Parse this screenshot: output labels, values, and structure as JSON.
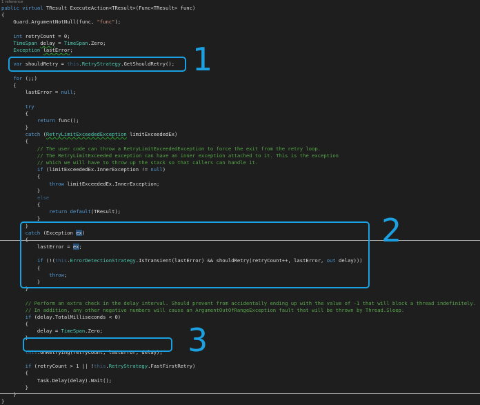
{
  "editor": {
    "reference_lens": "1 reference",
    "lines": [
      [
        {
          "t": "public ",
          "c": "kw"
        },
        {
          "t": "virtual ",
          "c": "kw"
        },
        {
          "t": "TResult ExecuteAction<TResult>(Func<TResult> func)",
          "c": "id"
        }
      ],
      [
        {
          "t": "{",
          "c": "id"
        }
      ],
      [
        {
          "t": "    Guard.ArgumentNotNull(func, ",
          "c": "id"
        },
        {
          "t": "\"func\"",
          "c": "st"
        },
        {
          "t": ");",
          "c": "id"
        }
      ],
      [],
      [
        {
          "t": "    ",
          "c": "id"
        },
        {
          "t": "int",
          "c": "kw"
        },
        {
          "t": " retryCount = 0;",
          "c": "id"
        }
      ],
      [
        {
          "t": "    ",
          "c": "id"
        },
        {
          "t": "TimeSpan",
          "c": "ty"
        },
        {
          "t": " ",
          "c": "id"
        },
        {
          "t": "delay",
          "c": "id sq"
        },
        {
          "t": " = ",
          "c": "id"
        },
        {
          "t": "TimeSpan",
          "c": "ty"
        },
        {
          "t": ".Zero;",
          "c": "id"
        }
      ],
      [
        {
          "t": "    Exception ",
          "c": "ty"
        },
        {
          "t": "lastError",
          "c": "id sq"
        },
        {
          "t": ";",
          "c": "id"
        }
      ],
      [],
      [
        {
          "t": "    ",
          "c": "id"
        },
        {
          "t": "var",
          "c": "kw"
        },
        {
          "t": " shouldRetry = ",
          "c": "id"
        },
        {
          "t": "this",
          "c": "this"
        },
        {
          "t": ".",
          "c": "id"
        },
        {
          "t": "RetryStrategy",
          "c": "ty"
        },
        {
          "t": ".GetShouldRetry();",
          "c": "id"
        }
      ],
      [],
      [
        {
          "t": "    ",
          "c": "id"
        },
        {
          "t": "for",
          "c": "kw"
        },
        {
          "t": " (;;)",
          "c": "id"
        }
      ],
      [
        {
          "t": "    {",
          "c": "id"
        }
      ],
      [
        {
          "t": "        lastError = ",
          "c": "id"
        },
        {
          "t": "null",
          "c": "kw"
        },
        {
          "t": ";",
          "c": "id"
        }
      ],
      [],
      [
        {
          "t": "        ",
          "c": "id"
        },
        {
          "t": "try",
          "c": "kw"
        }
      ],
      [
        {
          "t": "        {",
          "c": "id"
        }
      ],
      [
        {
          "t": "            ",
          "c": "id"
        },
        {
          "t": "return",
          "c": "kw"
        },
        {
          "t": " func();",
          "c": "id"
        }
      ],
      [
        {
          "t": "        }",
          "c": "id"
        }
      ],
      [
        {
          "t": "        ",
          "c": "id"
        },
        {
          "t": "catch",
          "c": "kw"
        },
        {
          "t": " (",
          "c": "id"
        },
        {
          "t": "RetryLimitExceededException",
          "c": "ty sq"
        },
        {
          "t": " limitExceededEx)",
          "c": "id"
        }
      ],
      [
        {
          "t": "        {",
          "c": "id"
        }
      ],
      [
        {
          "t": "            // The user code can throw a RetryLimitExceededException to force the exit from the retry loop.",
          "c": "cm"
        }
      ],
      [
        {
          "t": "            // The RetryLimitExceeded exception can have an inner exception attached to it. This is the exception",
          "c": "cm"
        }
      ],
      [
        {
          "t": "            // which we will have to throw up the stack so that callers can handle it.",
          "c": "cm"
        }
      ],
      [
        {
          "t": "            ",
          "c": "id"
        },
        {
          "t": "if",
          "c": "kw"
        },
        {
          "t": " (limitExceededEx.InnerException != ",
          "c": "id"
        },
        {
          "t": "null",
          "c": "kw"
        },
        {
          "t": ")",
          "c": "id"
        }
      ],
      [
        {
          "t": "            {",
          "c": "id"
        }
      ],
      [
        {
          "t": "                ",
          "c": "id"
        },
        {
          "t": "throw",
          "c": "kw"
        },
        {
          "t": " limitExceededEx.InnerException;",
          "c": "id"
        }
      ],
      [
        {
          "t": "            }",
          "c": "id"
        }
      ],
      [
        {
          "t": "            ",
          "c": "id"
        },
        {
          "t": "else",
          "c": "dim"
        }
      ],
      [
        {
          "t": "            {",
          "c": "id"
        }
      ],
      [
        {
          "t": "                ",
          "c": "id"
        },
        {
          "t": "return",
          "c": "kw"
        },
        {
          "t": " ",
          "c": "id"
        },
        {
          "t": "default",
          "c": "kw"
        },
        {
          "t": "(TResult);",
          "c": "id"
        }
      ],
      [
        {
          "t": "            }",
          "c": "id"
        }
      ],
      [
        {
          "t": "        }",
          "c": "id"
        }
      ],
      [
        {
          "t": "        ",
          "c": "id"
        },
        {
          "t": "catch",
          "c": "kw"
        },
        {
          "t": " (Exception ",
          "c": "id"
        },
        {
          "t": "ex",
          "c": "hl"
        },
        {
          "t": ")",
          "c": "id"
        }
      ],
      [
        {
          "t": "        {",
          "c": "id"
        }
      ],
      [
        {
          "t": "            lastError = ",
          "c": "id"
        },
        {
          "t": "ex",
          "c": "hl"
        },
        {
          "t": ";",
          "c": "id"
        }
      ],
      [],
      [
        {
          "t": "            ",
          "c": "id"
        },
        {
          "t": "if",
          "c": "kw"
        },
        {
          "t": " (!(",
          "c": "id"
        },
        {
          "t": "this",
          "c": "this"
        },
        {
          "t": ".",
          "c": "id"
        },
        {
          "t": "ErrorDetectionStrategy",
          "c": "ty"
        },
        {
          "t": ".IsTransient(lastError) && shouldRetry(retryCount++, lastError, ",
          "c": "id"
        },
        {
          "t": "out",
          "c": "kw"
        },
        {
          "t": " delay)))",
          "c": "id"
        }
      ],
      [
        {
          "t": "            {",
          "c": "id"
        }
      ],
      [
        {
          "t": "                ",
          "c": "id"
        },
        {
          "t": "throw",
          "c": "kw"
        },
        {
          "t": ";",
          "c": "id"
        }
      ],
      [
        {
          "t": "            }",
          "c": "id"
        }
      ],
      [
        {
          "t": "        }",
          "c": "id"
        }
      ],
      [],
      [
        {
          "t": "        // Perform an extra check in the delay interval. Should prevent from accidentally ending up with the value of -1 that will block a thread indefinitely.",
          "c": "cm"
        }
      ],
      [
        {
          "t": "        // In addition, any other negative numbers will cause an ArgumentOutOfRangeException fault that will be thrown by Thread.Sleep.",
          "c": "cm"
        }
      ],
      [
        {
          "t": "        ",
          "c": "id"
        },
        {
          "t": "if",
          "c": "kw"
        },
        {
          "t": " (delay.TotalMilliseconds < 0)",
          "c": "id"
        }
      ],
      [
        {
          "t": "        {",
          "c": "id"
        }
      ],
      [
        {
          "t": "            delay = ",
          "c": "id"
        },
        {
          "t": "TimeSpan",
          "c": "ty"
        },
        {
          "t": ".Zero;",
          "c": "id"
        }
      ],
      [
        {
          "t": "        }",
          "c": "id"
        }
      ],
      [],
      [
        {
          "t": "        ",
          "c": "id"
        },
        {
          "t": "this",
          "c": "this"
        },
        {
          "t": ".OnRetrying(retryCount, lastError, delay);",
          "c": "id"
        }
      ],
      [],
      [
        {
          "t": "        ",
          "c": "id"
        },
        {
          "t": "if",
          "c": "kw"
        },
        {
          "t": " (retryCount > 1 || !",
          "c": "id"
        },
        {
          "t": "this",
          "c": "this"
        },
        {
          "t": ".",
          "c": "id"
        },
        {
          "t": "RetryStrategy",
          "c": "ty"
        },
        {
          "t": ".FastFirstRetry)",
          "c": "id"
        }
      ],
      [
        {
          "t": "        {",
          "c": "id"
        }
      ],
      [
        {
          "t": "            Task.Delay(delay).Wait();",
          "c": "id"
        }
      ],
      [
        {
          "t": "        }",
          "c": "id"
        }
      ],
      [
        {
          "t": "    }",
          "c": "id"
        }
      ],
      [
        {
          "t": "}",
          "c": "id"
        }
      ]
    ]
  },
  "annotations": [
    {
      "label": "1",
      "color": "#1ba1e2"
    },
    {
      "label": "2",
      "color": "#1ba1e2"
    },
    {
      "label": "3",
      "color": "#1ba1e2"
    }
  ]
}
